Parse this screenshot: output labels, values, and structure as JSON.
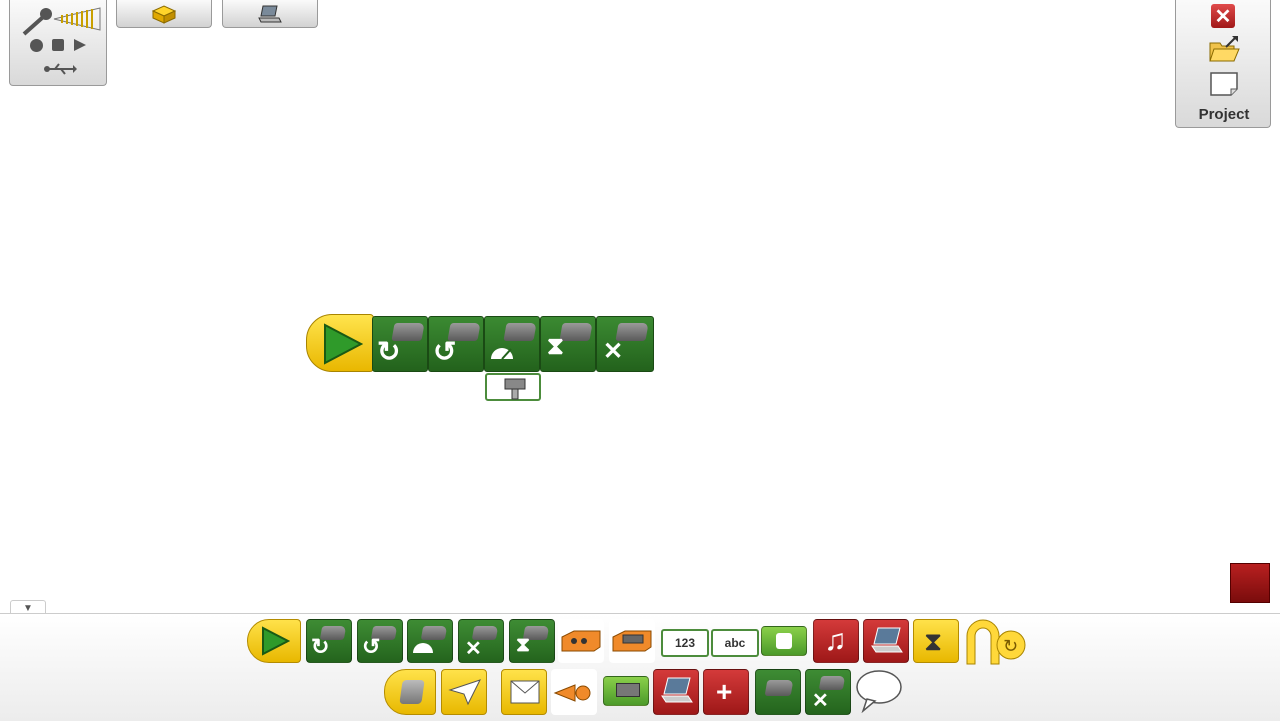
{
  "project_panel": {
    "label": "Project"
  },
  "palette_toggle": {
    "glyph": "▼"
  },
  "program": {
    "blocks": [
      {
        "name": "start-block",
        "icon": "play-icon"
      },
      {
        "name": "motor-this-way-block",
        "icon": "clockwise-arrow-icon"
      },
      {
        "name": "motor-that-way-block",
        "icon": "counterclockwise-arrow-icon"
      },
      {
        "name": "motor-power-block",
        "icon": "gauge-icon"
      },
      {
        "name": "wait-for-block",
        "icon": "hourglass-icon"
      },
      {
        "name": "motor-off-block",
        "icon": "x-icon"
      }
    ],
    "input_icon": "tilt-sensor-icon"
  },
  "palette": {
    "row1": [
      "start",
      "motor-this-way",
      "motor-that-way",
      "motor-power",
      "motor-off",
      "motor-on-for",
      "motion-sensor",
      "tilt-sensor",
      "number-input",
      "text-input",
      "random-input",
      "play-sound",
      "display",
      "wait-for",
      "repeat"
    ],
    "row1_labels": {
      "number": "123",
      "text": "abc"
    },
    "row2": [
      "start-on-key",
      "start-on-message",
      "send-message",
      "sound-sensor",
      "display-background",
      "display-add",
      "display-subtract",
      "motor-power-chain",
      "motor-multiply",
      "speech-bubble"
    ]
  }
}
